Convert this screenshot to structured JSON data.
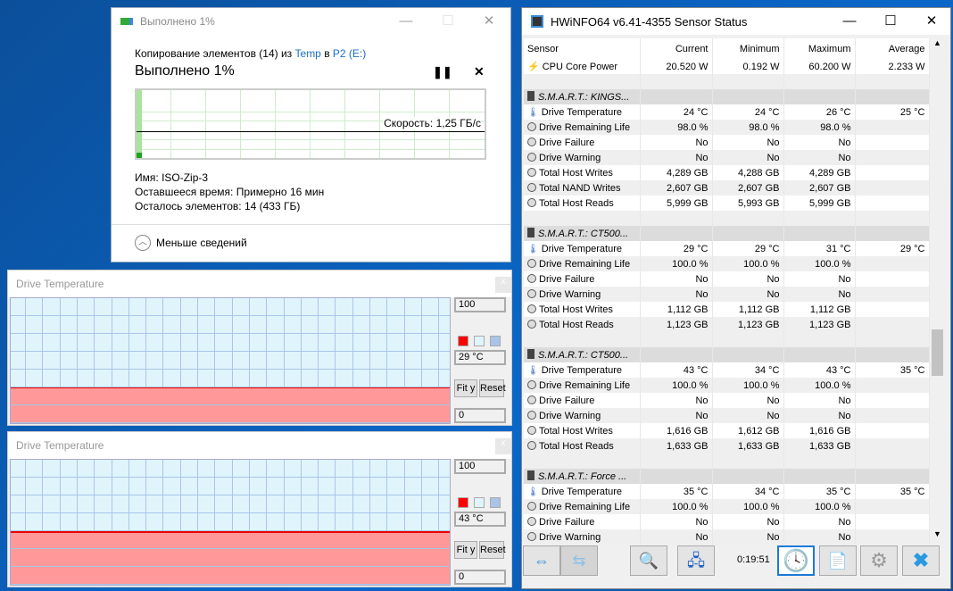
{
  "copy_dialog": {
    "title": "Выполнено 1%",
    "desc_prefix": "Копирование элементов (14) из ",
    "src": "Temp",
    "mid": " в ",
    "dst": "P2 (E:)",
    "heading": "Выполнено 1%",
    "speed": "Скорость: 1,25 ГБ/с",
    "progress_percent": 1,
    "name_label": "Имя:",
    "name_value": "ISO-Zip-3",
    "time_label": "Оставшееся время:",
    "time_value": "Примерно 16 мин",
    "items_label": "Осталось элементов:",
    "items_value": "14 (433 ГБ)",
    "less_details": "Меньше сведений"
  },
  "graphs": [
    {
      "title": "Drive Temperature",
      "max": "100",
      "min": "0",
      "current": "29 °C",
      "value": 29,
      "fit": "Fit y",
      "reset": "Reset",
      "close": "x"
    },
    {
      "title": "Drive Temperature",
      "max": "100",
      "min": "0",
      "current": "43 °C",
      "value": 43,
      "fit": "Fit y",
      "reset": "Reset",
      "close": "x"
    }
  ],
  "hwinfo": {
    "title": "HWiNFO64 v6.41-4355 Sensor Status",
    "time": "0:19:51",
    "columns": [
      "Sensor",
      "Current",
      "Minimum",
      "Maximum",
      "Average"
    ],
    "rows": [
      {
        "type": "row",
        "icon": "bolt",
        "c": [
          "CPU Core Power",
          "20.520 W",
          "0.192 W",
          "60.200 W",
          "2.233 W"
        ]
      },
      {
        "type": "blank",
        "c": [
          "",
          "",
          "",
          "",
          ""
        ]
      },
      {
        "type": "group",
        "c": [
          "S.M.A.R.T.: KINGS...",
          "",
          "",
          "",
          ""
        ]
      },
      {
        "type": "row",
        "icon": "therm",
        "c": [
          "Drive Temperature",
          "24 °C",
          "24 °C",
          "26 °C",
          "25 °C"
        ]
      },
      {
        "type": "row",
        "c": [
          "Drive Remaining Life",
          "98.0 %",
          "98.0 %",
          "98.0 %",
          ""
        ]
      },
      {
        "type": "row",
        "c": [
          "Drive Failure",
          "No",
          "No",
          "No",
          ""
        ]
      },
      {
        "type": "row",
        "c": [
          "Drive Warning",
          "No",
          "No",
          "No",
          ""
        ]
      },
      {
        "type": "row",
        "c": [
          "Total Host Writes",
          "4,289 GB",
          "4,288 GB",
          "4,289 GB",
          ""
        ]
      },
      {
        "type": "row",
        "c": [
          "Total NAND Writes",
          "2,607 GB",
          "2,607 GB",
          "2,607 GB",
          ""
        ]
      },
      {
        "type": "row",
        "c": [
          "Total Host Reads",
          "5,999 GB",
          "5,993 GB",
          "5,999 GB",
          ""
        ]
      },
      {
        "type": "blank",
        "c": [
          "",
          "",
          "",
          "",
          ""
        ]
      },
      {
        "type": "group",
        "c": [
          "S.M.A.R.T.: CT500...",
          "",
          "",
          "",
          ""
        ]
      },
      {
        "type": "row",
        "icon": "therm",
        "c": [
          "Drive Temperature",
          "29 °C",
          "29 °C",
          "31 °C",
          "29 °C"
        ]
      },
      {
        "type": "row",
        "c": [
          "Drive Remaining Life",
          "100.0 %",
          "100.0 %",
          "100.0 %",
          ""
        ]
      },
      {
        "type": "row",
        "c": [
          "Drive Failure",
          "No",
          "No",
          "No",
          ""
        ]
      },
      {
        "type": "row",
        "c": [
          "Drive Warning",
          "No",
          "No",
          "No",
          ""
        ]
      },
      {
        "type": "row",
        "c": [
          "Total Host Writes",
          "1,112 GB",
          "1,112 GB",
          "1,112 GB",
          ""
        ]
      },
      {
        "type": "row",
        "c": [
          "Total Host Reads",
          "1,123 GB",
          "1,123 GB",
          "1,123 GB",
          ""
        ]
      },
      {
        "type": "blank",
        "c": [
          "",
          "",
          "",
          "",
          ""
        ]
      },
      {
        "type": "group",
        "c": [
          "S.M.A.R.T.: CT500...",
          "",
          "",
          "",
          ""
        ]
      },
      {
        "type": "row",
        "icon": "therm",
        "c": [
          "Drive Temperature",
          "43 °C",
          "34 °C",
          "43 °C",
          "35 °C"
        ]
      },
      {
        "type": "row",
        "c": [
          "Drive Remaining Life",
          "100.0 %",
          "100.0 %",
          "100.0 %",
          ""
        ]
      },
      {
        "type": "row",
        "c": [
          "Drive Failure",
          "No",
          "No",
          "No",
          ""
        ]
      },
      {
        "type": "row",
        "c": [
          "Drive Warning",
          "No",
          "No",
          "No",
          ""
        ]
      },
      {
        "type": "row",
        "c": [
          "Total Host Writes",
          "1,616 GB",
          "1,612 GB",
          "1,616 GB",
          ""
        ]
      },
      {
        "type": "row",
        "c": [
          "Total Host Reads",
          "1,633 GB",
          "1,633 GB",
          "1,633 GB",
          ""
        ]
      },
      {
        "type": "blank",
        "c": [
          "",
          "",
          "",
          "",
          ""
        ]
      },
      {
        "type": "group",
        "c": [
          "S.M.A.R.T.: Force ...",
          "",
          "",
          "",
          ""
        ]
      },
      {
        "type": "row",
        "icon": "therm",
        "c": [
          "Drive Temperature",
          "35 °C",
          "34 °C",
          "35 °C",
          "35 °C"
        ]
      },
      {
        "type": "row",
        "c": [
          "Drive Remaining Life",
          "100.0 %",
          "100.0 %",
          "100.0 %",
          ""
        ]
      },
      {
        "type": "row",
        "c": [
          "Drive Failure",
          "No",
          "No",
          "No",
          ""
        ]
      },
      {
        "type": "row",
        "c": [
          "Drive Warning",
          "No",
          "No",
          "No",
          ""
        ]
      }
    ]
  }
}
